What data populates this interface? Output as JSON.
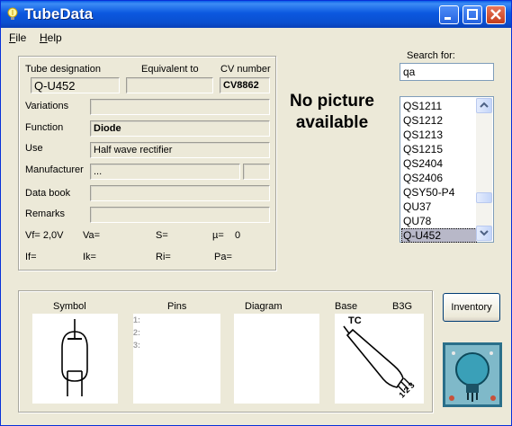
{
  "window": {
    "title": "TubeData"
  },
  "menu": {
    "file_label": "File",
    "help_label": "Help"
  },
  "form": {
    "tube_designation_label": "Tube designation",
    "equivalent_label": "Equivalent to",
    "cv_number_label": "CV number",
    "tube_designation_value": "Q-U452",
    "equivalent_value": "",
    "cv_number_value": "CV8862",
    "variations_label": "Variations",
    "variations_value": "",
    "function_label": "Function",
    "function_value": "Diode",
    "use_label": "Use",
    "use_value": "Half wave rectifier",
    "manufacturer_label": "Manufacturer",
    "manufacturer_value": "...",
    "data_book_label": "Data book",
    "data_book_value": "",
    "remarks_label": "Remarks",
    "remarks_value": "",
    "vf": "Vf= 2,0V",
    "va": "Va=",
    "s": "S=",
    "mu": "µ=",
    "mu_value": "0",
    "if": "If=",
    "ik": "Ik=",
    "ri": "Ri=",
    "pa": "Pa="
  },
  "picture": {
    "no_picture_text": "No picture available"
  },
  "search": {
    "label": "Search for:",
    "value": "qa",
    "results": [
      "QS1211",
      "QS1212",
      "QS1213",
      "QS1215",
      "QS2404",
      "QS2406",
      "QSY50-P4",
      "QU37",
      "QU78",
      "Q-U452"
    ],
    "selected": "Q-U452"
  },
  "bottom": {
    "symbol_label": "Symbol",
    "pins_label": "Pins",
    "diagram_label": "Diagram",
    "base_label": "Base",
    "base_value": "B3G",
    "pin_numbers": [
      "1:",
      "2:",
      "3:"
    ],
    "base_pin_label": "TC",
    "base_pin_numbers": "1 2 3"
  },
  "buttons": {
    "inventory_label": "Inventory"
  }
}
